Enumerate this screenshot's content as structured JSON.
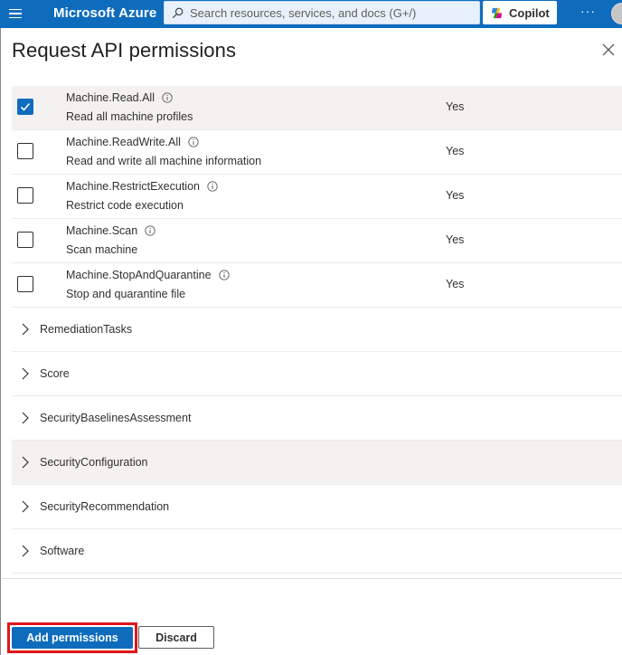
{
  "topbar": {
    "menu_icon": "hamburger-icon",
    "brand": "Microsoft Azure",
    "search_placeholder": "Search resources, services, and docs (G+/)",
    "copilot_label": "Copilot",
    "more_label": "···"
  },
  "panel": {
    "title": "Request API permissions",
    "permissions": [
      {
        "name": "Machine.Read.All",
        "description": "Read all machine profiles",
        "admin_consent": "Yes",
        "checked": true
      },
      {
        "name": "Machine.ReadWrite.All",
        "description": "Read and write all machine information",
        "admin_consent": "Yes",
        "checked": false
      },
      {
        "name": "Machine.RestrictExecution",
        "description": "Restrict code execution",
        "admin_consent": "Yes",
        "checked": false
      },
      {
        "name": "Machine.Scan",
        "description": "Scan machine",
        "admin_consent": "Yes",
        "checked": false
      },
      {
        "name": "Machine.StopAndQuarantine",
        "description": "Stop and quarantine file",
        "admin_consent": "Yes",
        "checked": false
      }
    ],
    "groups": [
      {
        "label": "RemediationTasks"
      },
      {
        "label": "Score"
      },
      {
        "label": "SecurityBaselinesAssessment"
      },
      {
        "label": "SecurityConfiguration",
        "hover": true
      },
      {
        "label": "SecurityRecommendation"
      },
      {
        "label": "Software"
      }
    ],
    "add_button": "Add permissions",
    "discard_button": "Discard"
  },
  "colors": {
    "accent": "#0f6cbd",
    "highlight_border": "#e0161e"
  }
}
